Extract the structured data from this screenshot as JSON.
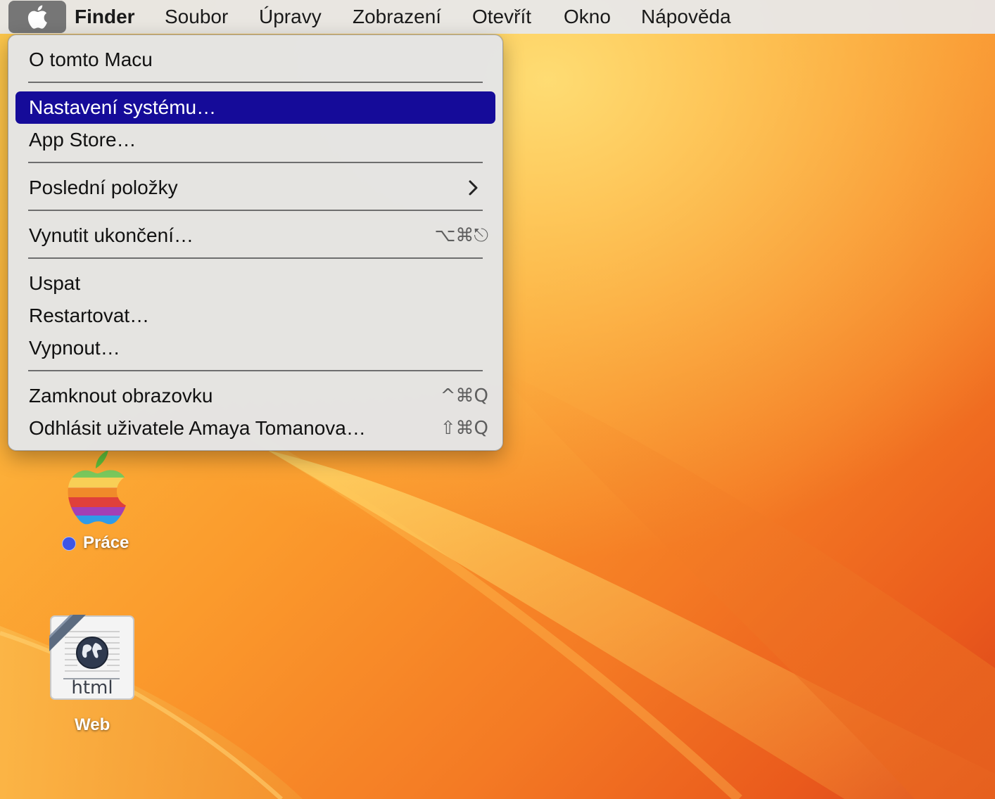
{
  "menubar": {
    "apple_icon": "apple-logo-icon",
    "app_name": "Finder",
    "items": [
      "Soubor",
      "Úpravy",
      "Zobrazení",
      "Otevřít",
      "Okno",
      "Nápověda"
    ]
  },
  "apple_menu": {
    "about": "O tomto Macu",
    "system_settings": "Nastavení systému…",
    "app_store": "App Store…",
    "recent_items": "Poslední položky",
    "force_quit": "Vynutit ukončení…",
    "force_quit_shortcut": "⌥⌘⎋",
    "sleep": "Uspat",
    "restart": "Restartovat…",
    "shut_down": "Vypnout…",
    "lock_screen": "Zamknout obrazovku",
    "lock_screen_shortcut": "^⌘Q",
    "log_out": "Odhlásit uživatele Amaya Tomanova…",
    "log_out_shortcut": "⇧⌘Q",
    "selected_item": "Nastavení systému…",
    "highlight_color": "#150b99"
  },
  "desktop": {
    "icons": [
      {
        "label": "Práce",
        "icon": "rainbow-apple-folder-icon",
        "tag_color": "#3d55e6"
      },
      {
        "label": "Web",
        "icon": "html-document-icon",
        "doc_text": "html"
      }
    ]
  }
}
